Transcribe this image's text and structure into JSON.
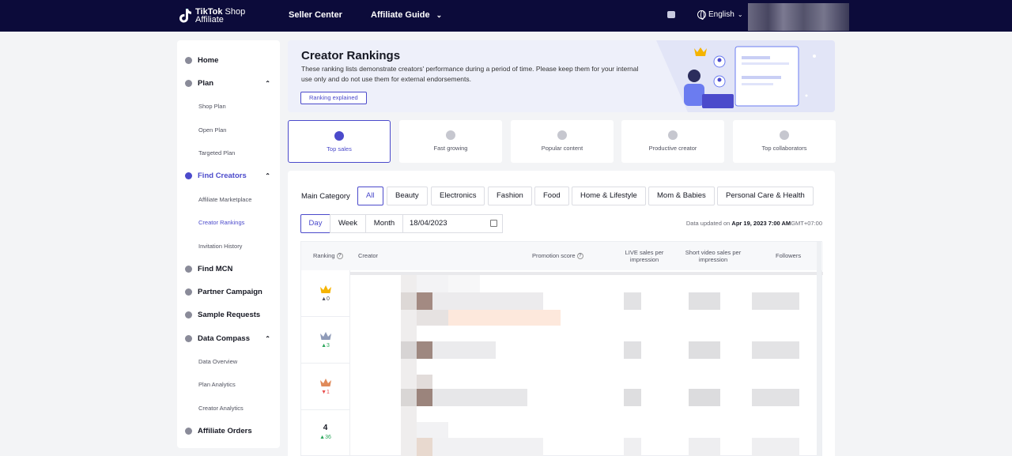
{
  "topbar": {
    "logo_line1": "TikTok",
    "logo_line1_suffix": "Shop",
    "logo_line2": "Affiliate",
    "seller_center": "Seller Center",
    "affiliate_guide": "Affiliate Guide",
    "language": "English"
  },
  "sidebar": {
    "items": [
      {
        "label": "Home",
        "icon": "home-icon"
      },
      {
        "label": "Plan",
        "icon": "plan-icon"
      },
      {
        "label": "Shop Plan"
      },
      {
        "label": "Open Plan"
      },
      {
        "label": "Targeted Plan"
      },
      {
        "label": "Find Creators",
        "icon": "search-user-icon"
      },
      {
        "label": "Affiliate Marketplace"
      },
      {
        "label": "Creator Rankings"
      },
      {
        "label": "Invitation History"
      },
      {
        "label": "Find MCN",
        "icon": "building-icon"
      },
      {
        "label": "Partner Campaign",
        "icon": "shield-icon"
      },
      {
        "label": "Sample Requests",
        "icon": "box-icon"
      },
      {
        "label": "Data Compass",
        "icon": "compass-icon"
      },
      {
        "label": "Data Overview"
      },
      {
        "label": "Plan Analytics"
      },
      {
        "label": "Creator Analytics"
      },
      {
        "label": "Affiliate Orders",
        "icon": "orders-icon"
      }
    ],
    "active_item": "Creator Rankings"
  },
  "banner": {
    "title": "Creator Rankings",
    "description": "These ranking lists demonstrate creators' performance during a period of time. Please keep them for your internal use only and do not use them for external endorsements.",
    "button": "Ranking explained"
  },
  "ranking_tabs": [
    {
      "label": "Top sales",
      "icon": "money-bag-icon",
      "active": true
    },
    {
      "label": "Fast growing",
      "icon": "rocket-icon",
      "active": false
    },
    {
      "label": "Popular content",
      "icon": "flame-icon",
      "active": false
    },
    {
      "label": "Productive creator",
      "icon": "badge-icon",
      "active": false
    },
    {
      "label": "Top collaborators",
      "icon": "handshake-icon",
      "active": false
    }
  ],
  "filters": {
    "category_label": "Main Category",
    "categories": [
      "All",
      "Beauty",
      "Electronics",
      "Fashion",
      "Food",
      "Home & Lifestyle",
      "Mom & Babies",
      "Personal Care & Health"
    ],
    "active_category": "All",
    "periods": [
      "Day",
      "Week",
      "Month"
    ],
    "active_period": "Day",
    "date": "18/04/2023",
    "updated_prefix": "Data updated on",
    "updated_value": "Apr 19, 2023 7:00 AM",
    "updated_tz": "GMT+07:00"
  },
  "table": {
    "headers": {
      "ranking": "Ranking",
      "creator": "Creator",
      "promotion_score": "Promotion score",
      "live_sales_1": "LIVE sales per",
      "live_sales_2": "impression",
      "video_sales_1": "Short video sales per",
      "video_sales_2": "impression",
      "followers": "Followers"
    },
    "rows": [
      {
        "rank": "1",
        "crown": "gold",
        "delta": "0",
        "delta_dir": "same"
      },
      {
        "rank": "2",
        "crown": "silver",
        "delta": "3",
        "delta_dir": "up"
      },
      {
        "rank": "3",
        "crown": "bronze",
        "delta": "1",
        "delta_dir": "down"
      },
      {
        "rank": "4",
        "crown": "none",
        "delta": "36",
        "delta_dir": "up"
      }
    ]
  },
  "colors": {
    "brand_navy": "#0c0b3a",
    "accent": "#4b4acb",
    "up": "#2aa65a",
    "down": "#e84c4c",
    "gold": "#f5b400",
    "silver": "#8f9bb8",
    "bronze": "#e08a5a"
  }
}
